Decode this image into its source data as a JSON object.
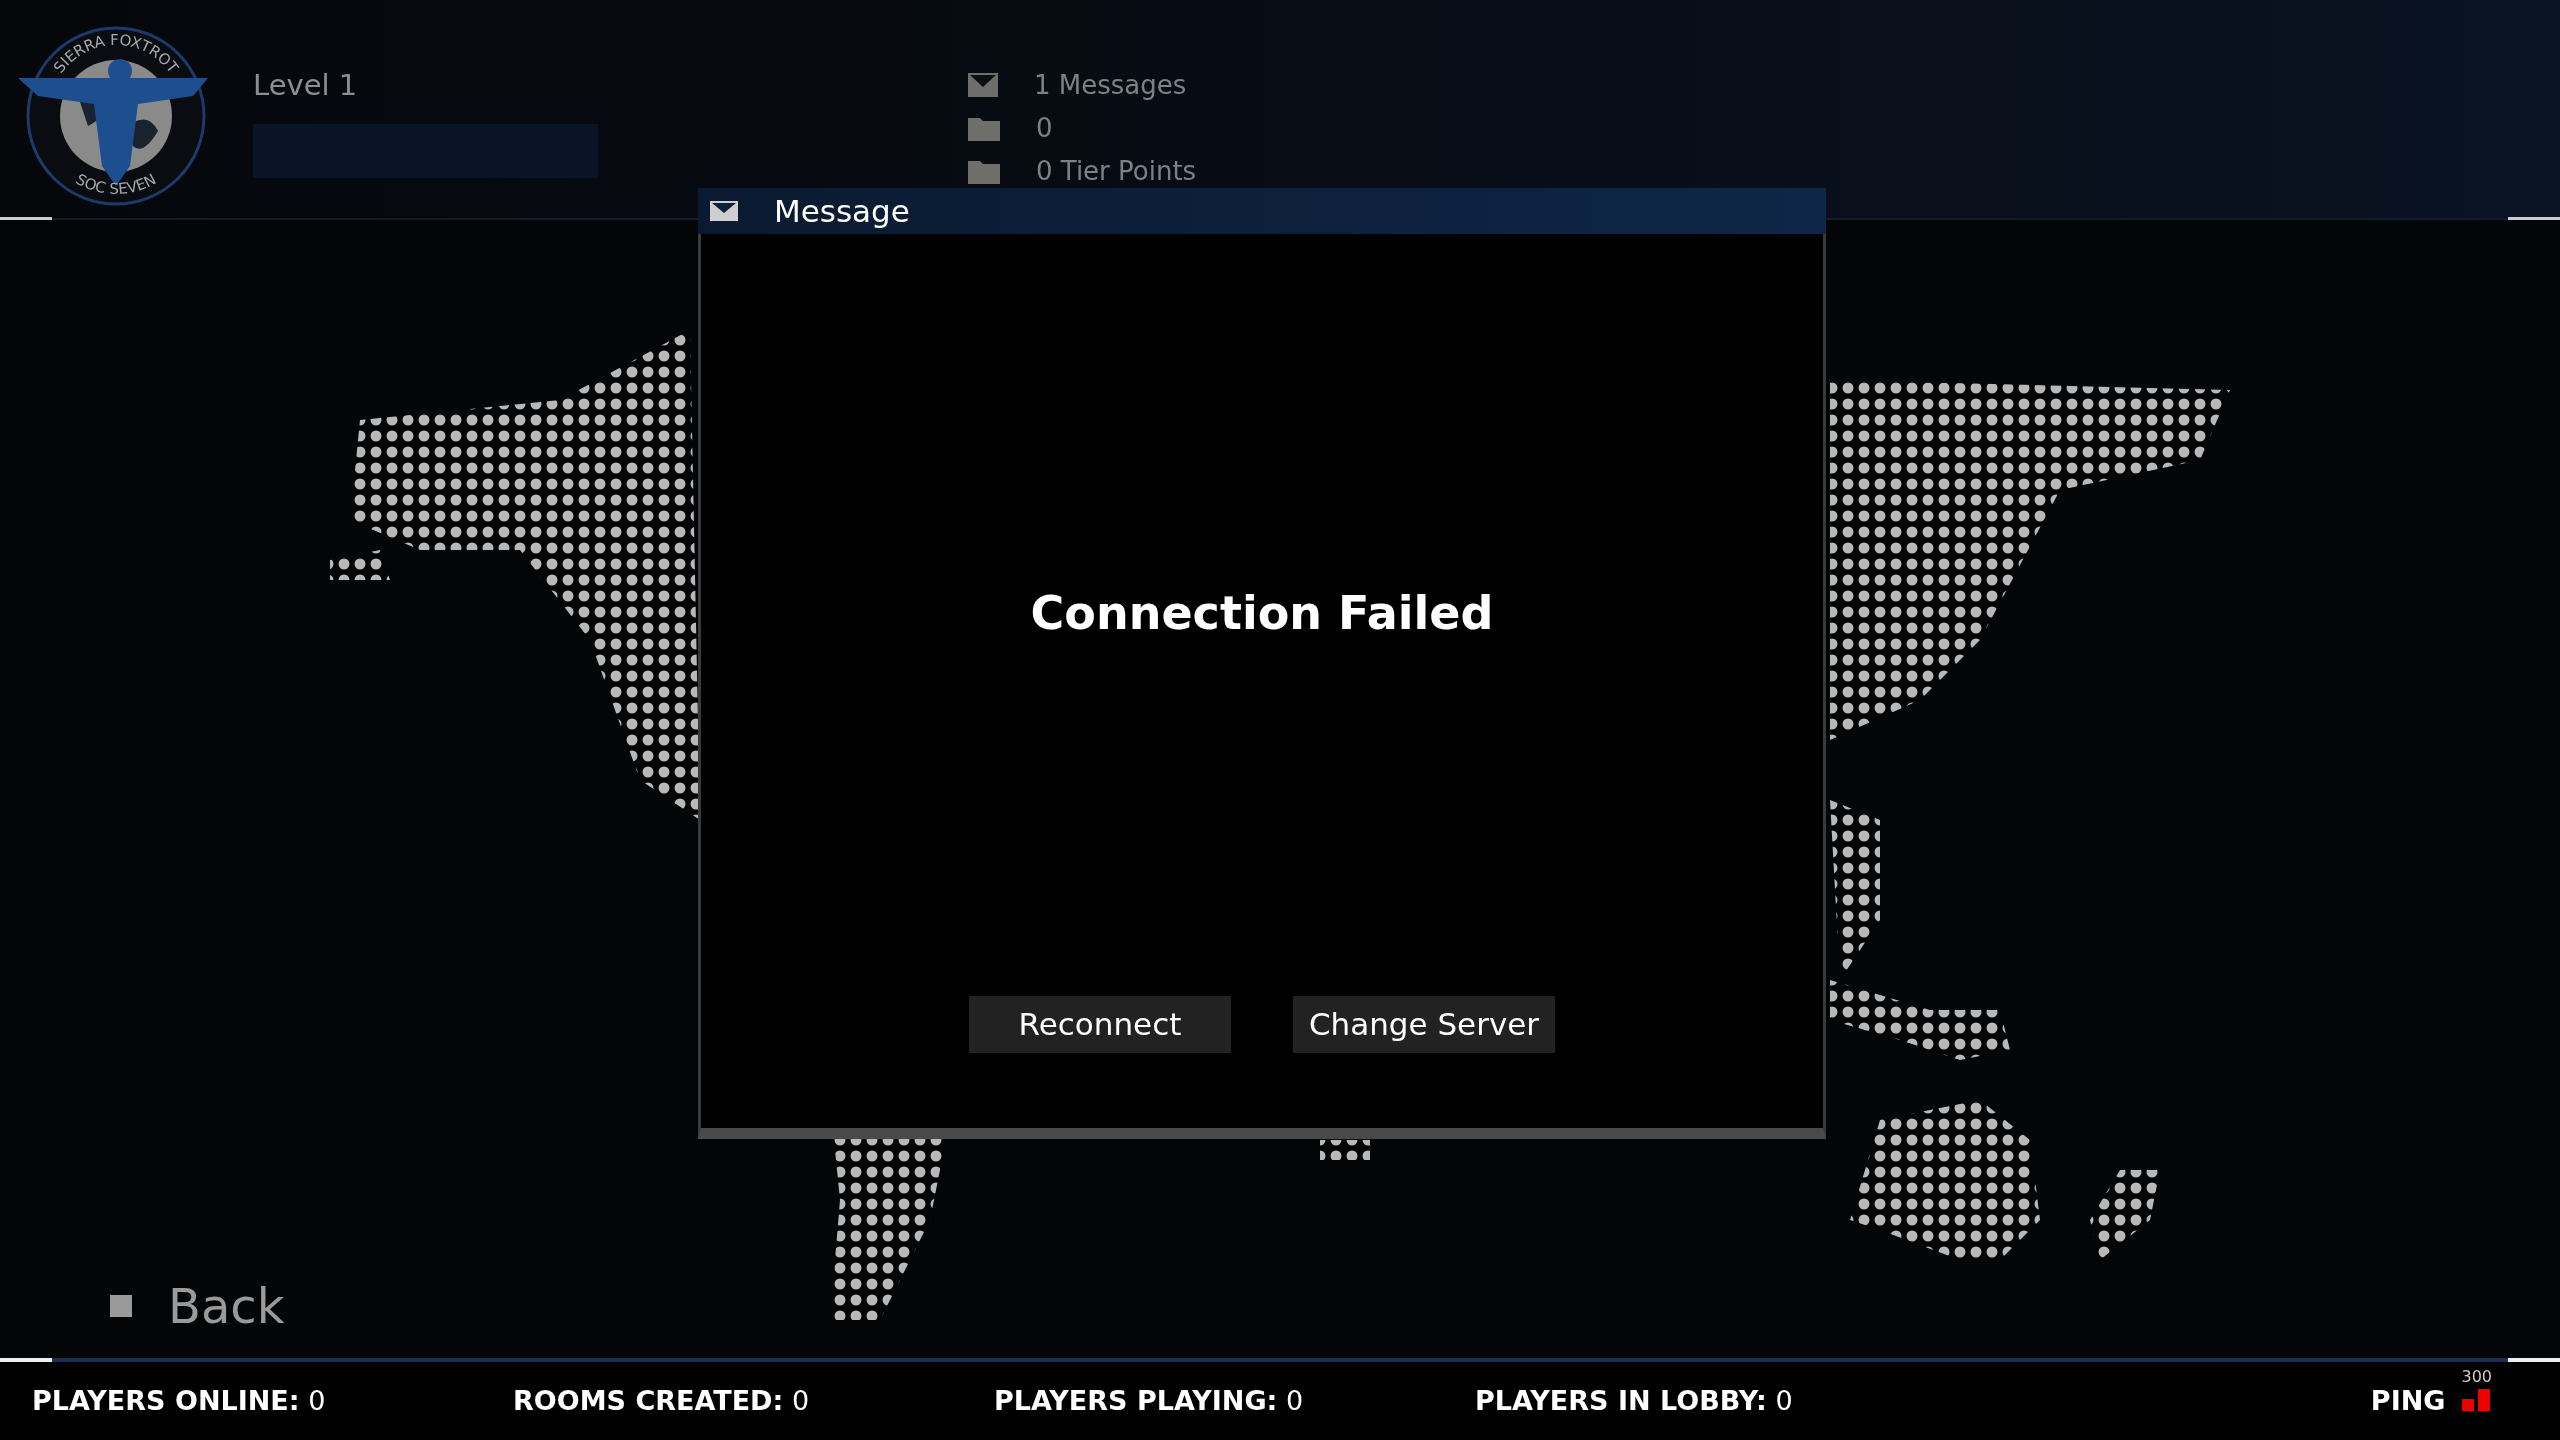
{
  "logo": {
    "top_text": "SIERRA FOXTROT",
    "bottom_text": "SOC SEVEN"
  },
  "player": {
    "level_label": "Level 1",
    "xp_bar": {
      "level": 0
    }
  },
  "stats": [
    {
      "kind": "mail",
      "text": "1 Messages"
    },
    {
      "kind": "folder",
      "text": "0"
    },
    {
      "kind": "folder",
      "text": "0 Tier Points"
    }
  ],
  "dialog": {
    "title": "Message",
    "message": "Connection Failed",
    "buttons": [
      "Reconnect",
      "Change Server"
    ]
  },
  "back": {
    "label": "Back"
  },
  "status_bar": [
    {
      "text": "**PLAYERS ONLINE:** 0"
    },
    {
      "text": "**ROOMS CREATED:** 0"
    },
    {
      "text": "**PLAYERS PLAYING:** 0"
    },
    {
      "text": "**PLAYERS IN LOBBY:** 0"
    }
  ],
  "ping": {
    "label": "PING",
    "reading": "300"
  }
}
